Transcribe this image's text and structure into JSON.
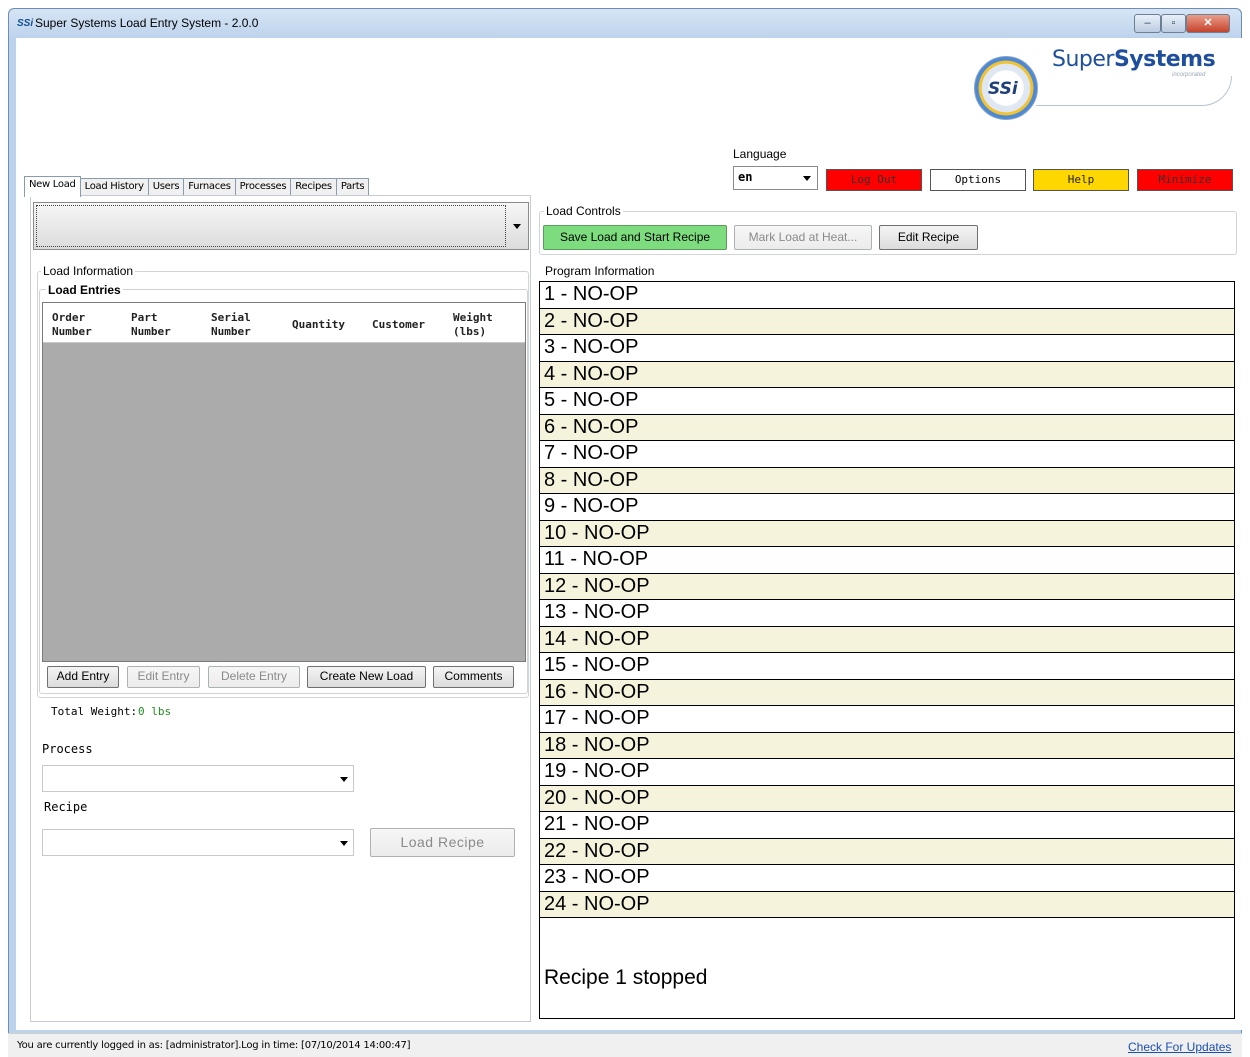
{
  "window": {
    "app_icon": "SSi",
    "title": "Super Systems Load Entry System - 2.0.0",
    "controls": {
      "minimize": "–",
      "maximize": "▫",
      "close": "✕"
    }
  },
  "logo": {
    "mark": "SSi",
    "word_light": "Super",
    "word_bold": "Systems",
    "sub": "incorporated"
  },
  "toolbar": {
    "language_label": "Language",
    "language_value": "en",
    "logout": "Log Out",
    "options": "Options",
    "help": "Help",
    "minimize": "Minimize",
    "colors": {
      "logout": "#ff0000",
      "help": "#ffd700",
      "minimize": "#ff0000"
    }
  },
  "tabs": [
    "New Load",
    "Load History",
    "Users",
    "Furnaces",
    "Processes",
    "Recipes",
    "Parts"
  ],
  "load_info": {
    "title": "Load Information",
    "entries_title": "Load Entries",
    "columns": [
      {
        "label": "Order Number",
        "width": 79
      },
      {
        "label": "Part Number",
        "width": 80
      },
      {
        "label": "Serial Number",
        "width": 81
      },
      {
        "label": "Quantity",
        "width": 80
      },
      {
        "label": "Customer",
        "width": 81
      },
      {
        "label": "Weight (lbs)",
        "width": 80
      }
    ],
    "buttons": {
      "add": "Add Entry",
      "edit": "Edit Entry",
      "delete": "Delete Entry",
      "create": "Create New Load",
      "comments": "Comments"
    },
    "total_weight_label": "Total Weight:",
    "total_weight_value": "0 lbs",
    "process_label": "Process",
    "recipe_label": "Recipe",
    "load_recipe": "Load Recipe"
  },
  "load_controls": {
    "title": "Load Controls",
    "save": "Save Load and Start Recipe",
    "mark": "Mark Load at Heat...",
    "edit_recipe": "Edit Recipe"
  },
  "program": {
    "title": "Program Information",
    "steps": [
      "1 - NO-OP",
      "2 - NO-OP",
      "3 - NO-OP",
      "4 - NO-OP",
      "5 - NO-OP",
      "6 - NO-OP",
      "7 - NO-OP",
      "8 - NO-OP",
      "9 - NO-OP",
      "10 - NO-OP",
      "11 - NO-OP",
      "12 - NO-OP",
      "13 - NO-OP",
      "14 - NO-OP",
      "15 - NO-OP",
      "16 - NO-OP",
      "17 - NO-OP",
      "18 - NO-OP",
      "19 - NO-OP",
      "20 - NO-OP",
      "21 - NO-OP",
      "22 - NO-OP",
      "23 - NO-OP",
      "24 - NO-OP"
    ],
    "status": "Recipe 1 stopped"
  },
  "status_bar": {
    "text": "You are currently logged in as: [administrator].Log in time: [07/10/2014 14:00:47]",
    "check_updates": "Check For Updates"
  }
}
